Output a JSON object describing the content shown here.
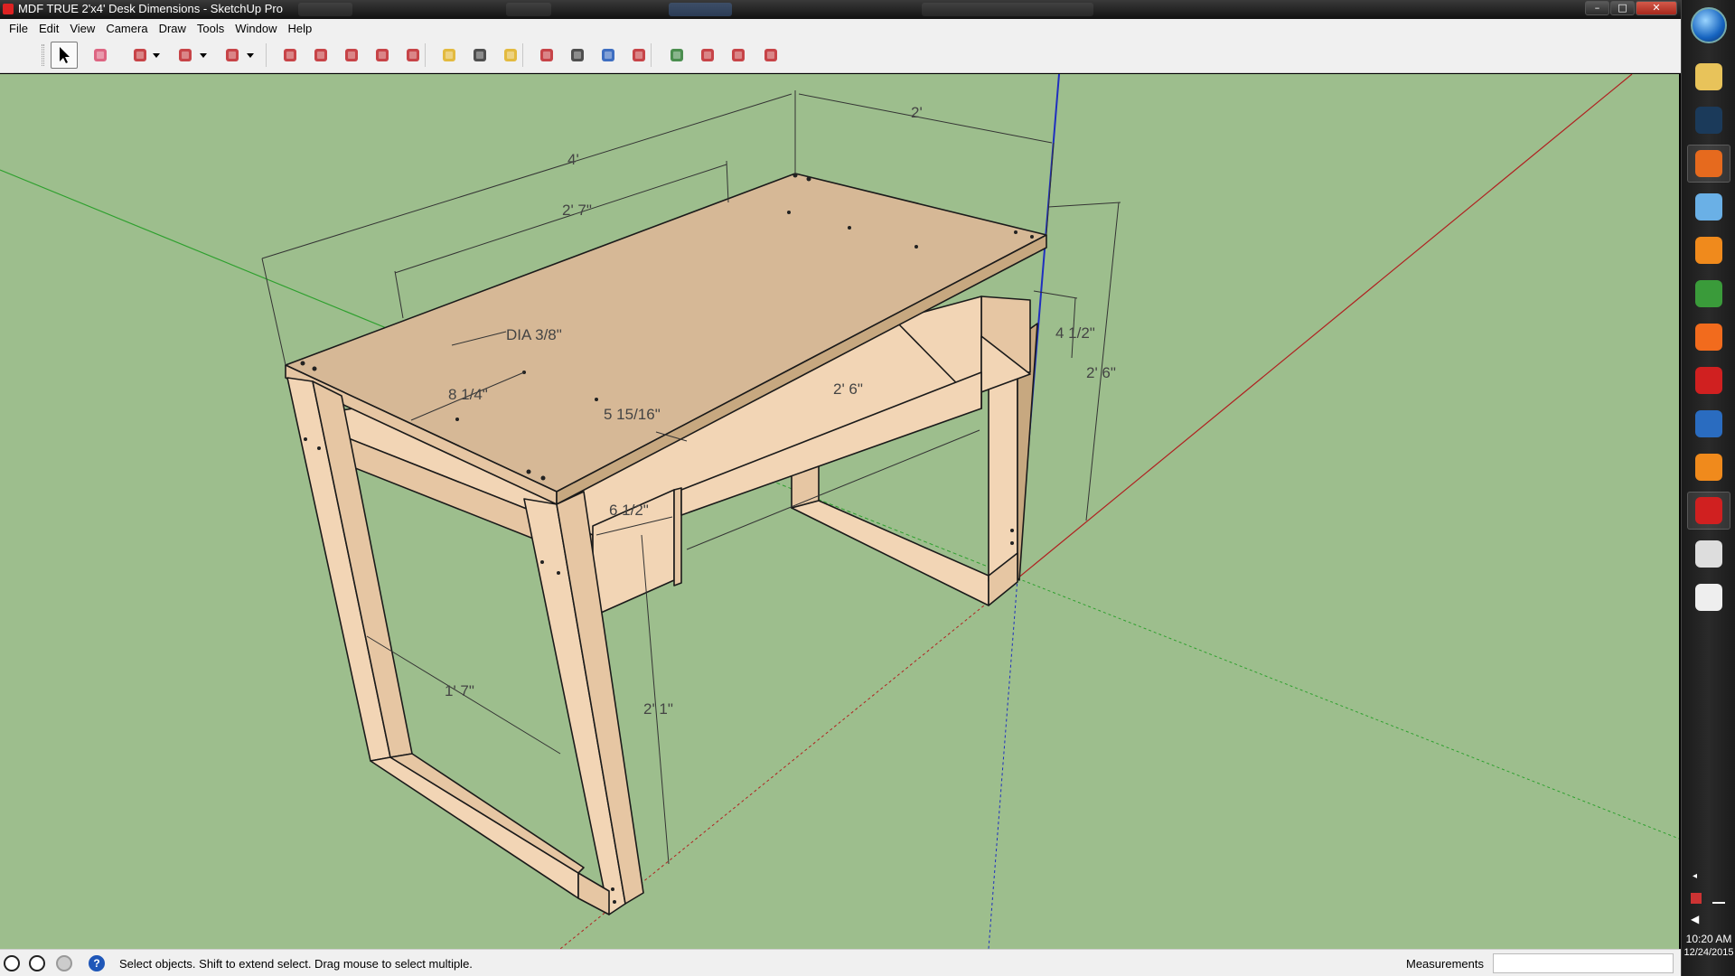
{
  "window": {
    "title": "MDF TRUE 2'x4' Desk Dimensions - SketchUp Pro",
    "controls": {
      "minimize": "–",
      "maximize": "□",
      "close": "✕"
    }
  },
  "menu": [
    "File",
    "Edit",
    "View",
    "Camera",
    "Draw",
    "Tools",
    "Window",
    "Help"
  ],
  "toolbar": {
    "tools": [
      {
        "name": "select-tool-icon",
        "color": "#000000",
        "active": true
      },
      {
        "name": "eraser-tool-icon",
        "color": "#d94c6f"
      },
      {
        "name": "line-tool-icon",
        "color": "#c0262a"
      },
      {
        "name": "line-dropdown-icon",
        "color": "#000000"
      },
      {
        "name": "arc-tool-icon",
        "color": "#c0262a"
      },
      {
        "name": "arc-dropdown-icon",
        "color": "#000000"
      },
      {
        "name": "shape-tool-icon",
        "color": "#c0262a"
      },
      {
        "name": "shape-dropdown-icon",
        "color": "#000000"
      },
      {
        "name": "push-pull-icon",
        "color": "#c0262a"
      },
      {
        "name": "follow-me-icon",
        "color": "#c0262a"
      },
      {
        "name": "move-icon",
        "color": "#c0262a"
      },
      {
        "name": "rotate-icon",
        "color": "#c0262a"
      },
      {
        "name": "scale-icon",
        "color": "#c0262a"
      },
      {
        "name": "tape-measure-icon",
        "color": "#e0b020"
      },
      {
        "name": "text-tool-icon",
        "color": "#333333"
      },
      {
        "name": "paint-bucket-icon",
        "color": "#e0b020"
      },
      {
        "name": "orbit-icon",
        "color": "#c0262a"
      },
      {
        "name": "pan-icon",
        "color": "#333333"
      },
      {
        "name": "zoom-icon",
        "color": "#1f57b8"
      },
      {
        "name": "zoom-extents-icon",
        "color": "#c0262a"
      },
      {
        "name": "3d-warehouse-icon",
        "color": "#2e7d32"
      },
      {
        "name": "extension-warehouse-icon",
        "color": "#c0262a"
      },
      {
        "name": "share-model-icon",
        "color": "#c0262a"
      },
      {
        "name": "layout-send-icon",
        "color": "#c0262a"
      }
    ]
  },
  "model": {
    "colors": {
      "background": "#9dbe8d",
      "wood_top": "#d6b896",
      "wood_light": "#f2d5b5",
      "wood_mid": "#e6c6a3",
      "wood_dark": "#c7a880",
      "axis_red": "#b02020",
      "axis_green": "#2ea02e",
      "axis_blue": "#1f2fbf"
    },
    "dimensions": [
      "4'",
      "2'",
      "2' 7\"",
      "DIA 3/8\"",
      "8 1/4\"",
      "5 15/16\"",
      "2' 6\"",
      "4 1/2\"",
      "2' 6\"",
      "6 1/2\"",
      "1' 7\"",
      "2' 1\""
    ]
  },
  "statusbar": {
    "message": "Select objects. Shift to extend select. Drag mouse to select multiple.",
    "measurements_label": "Measurements",
    "measurements_value": "",
    "help_icon_text": "?"
  },
  "taskbar": {
    "apps": [
      {
        "name": "file-explorer-icon",
        "color": "#e8c35a"
      },
      {
        "name": "steam-icon",
        "color": "#1b3a5a"
      },
      {
        "name": "firefox-icon",
        "color": "#e66a1e",
        "running": true
      },
      {
        "name": "paint-app-icon",
        "color": "#6ab0e6"
      },
      {
        "name": "media-player-icon",
        "color": "#f08a1c"
      },
      {
        "name": "chrome-icon",
        "color": "#3a9b3a"
      },
      {
        "name": "origin-icon",
        "color": "#f26b1d"
      },
      {
        "name": "acrobat-icon",
        "color": "#d02020"
      },
      {
        "name": "settings-app-icon",
        "color": "#2a6cc0"
      },
      {
        "name": "vlc-icon",
        "color": "#f08a1c"
      },
      {
        "name": "sketchup-icon",
        "color": "#d02020",
        "running": true
      },
      {
        "name": "gamepad-icon",
        "color": "#dddddd"
      },
      {
        "name": "calendar-app-icon",
        "color": "#eeeeee"
      }
    ],
    "clock_time": "10:20 AM",
    "clock_date": "12/24/2015"
  }
}
